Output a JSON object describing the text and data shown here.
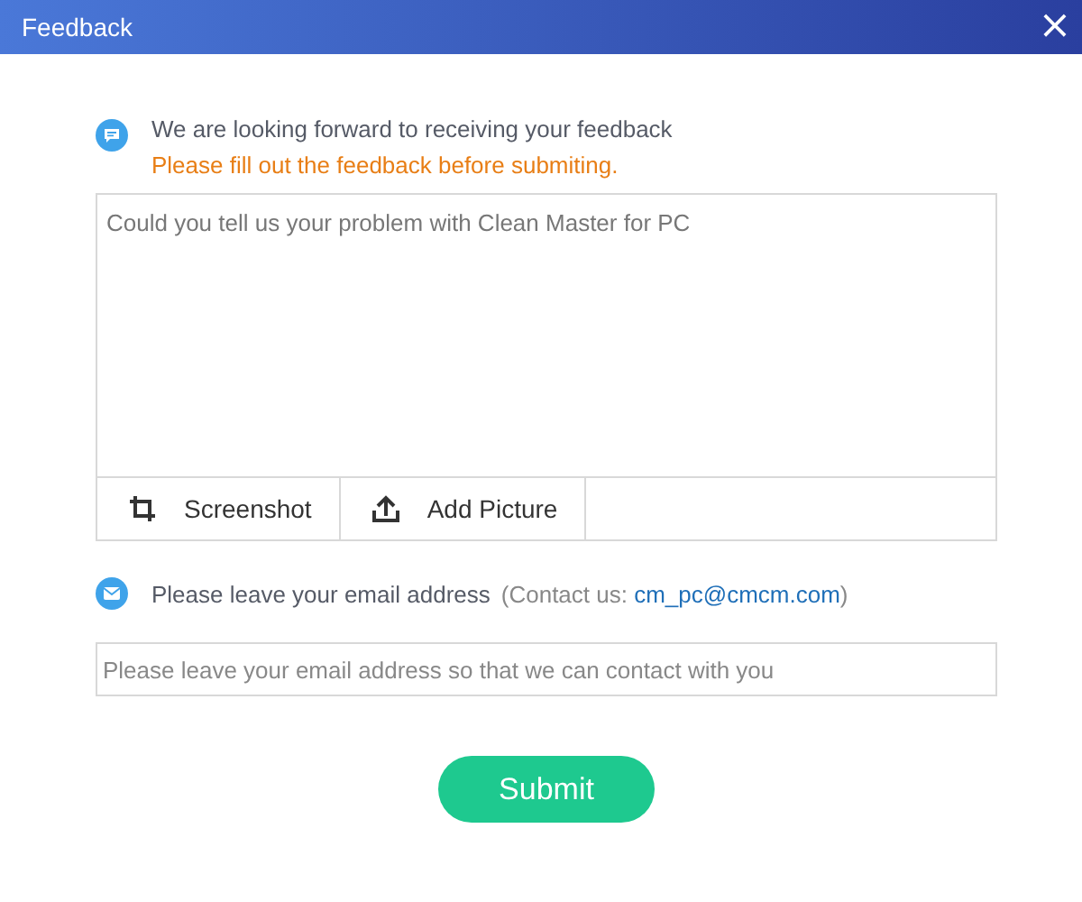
{
  "window": {
    "title": "Feedback",
    "close": "×"
  },
  "intro": {
    "heading": "We are looking forward to receiving your feedback",
    "warning": "Please fill out the feedback before submiting."
  },
  "feedback": {
    "placeholder": "Could you tell us your problem with Clean Master for PC"
  },
  "tools": [
    {
      "kind": "crop",
      "label": "Screenshot"
    },
    {
      "kind": "upload",
      "label": "Add Picture"
    }
  ],
  "email_section": {
    "label": "Please leave your email address",
    "contact_prefix": "(Contact us: ",
    "contact_email": "cm_pc@cmcm.com",
    "contact_suffix": ")"
  },
  "email": {
    "placeholder": "Please leave your email address so that we can contact with you"
  },
  "submit": "Submit"
}
